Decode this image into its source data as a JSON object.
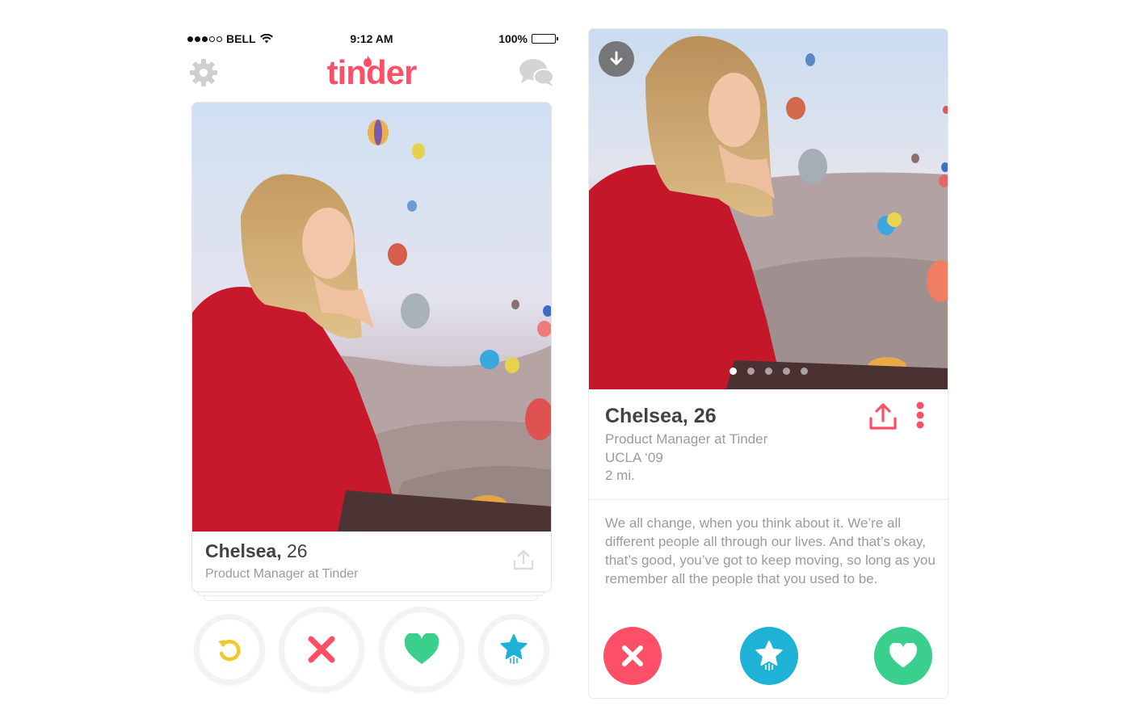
{
  "status_bar": {
    "carrier": "BELL",
    "time": "9:12 AM",
    "battery": "100%",
    "battery_level": 1.0
  },
  "nav": {
    "logo": "tinder"
  },
  "card": {
    "name": "Chelsea",
    "age": "26",
    "job": "Product Manager at Tinder"
  },
  "profile": {
    "name": "Chelsea",
    "age": "26",
    "job": "Product Manager at Tinder",
    "school": "UCLA ‘09",
    "distance": "2 mi.",
    "bio": "We all change, when you think about it. We’re all different people all through our lives. And that’s okay, that’s good, you’ve got to keep moving, so long as you remember all the people that you used to be.",
    "photo_count": 5,
    "active_photo": 1
  },
  "colors": {
    "brand": "#fd5068",
    "nope": "#fd5068",
    "superlike": "#1eb3d6",
    "like": "#3bcf8e",
    "rewind": "#f5c72f",
    "secondary_text": "#9b9b9b"
  },
  "icons": [
    "gear-icon",
    "flame-icon",
    "chat-icon",
    "share-icon",
    "rewind-icon",
    "close-icon",
    "heart-icon",
    "star-icon",
    "arrow-down-icon",
    "more-vertical-icon"
  ]
}
